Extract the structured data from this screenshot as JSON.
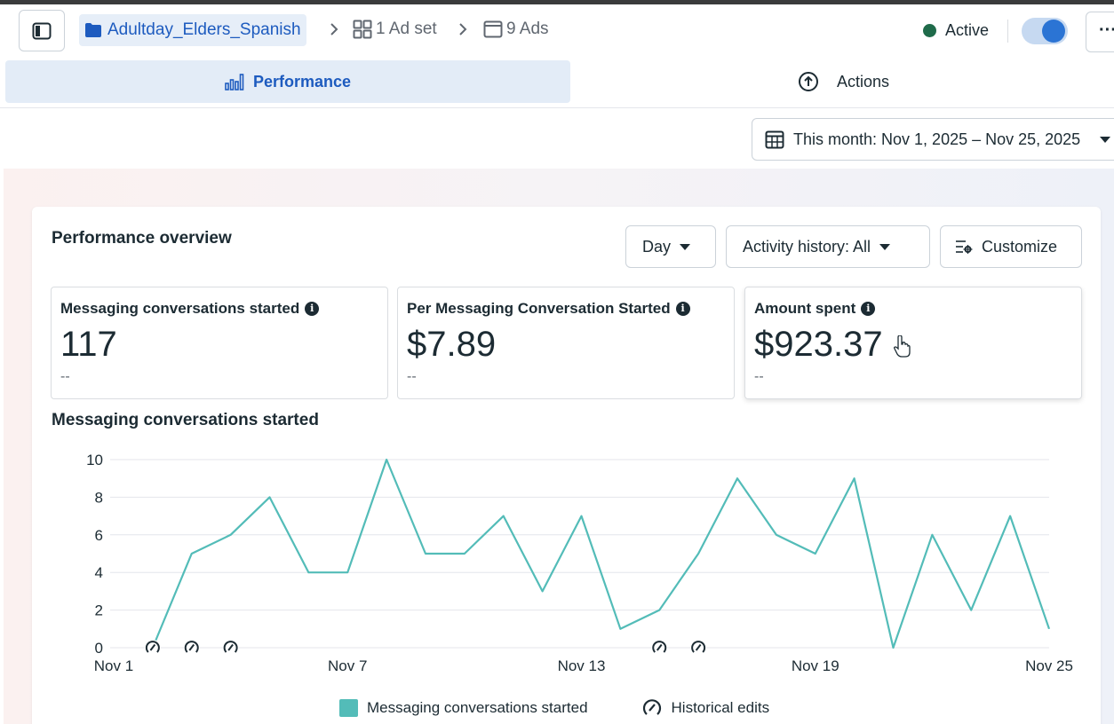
{
  "header": {
    "campaign_name": "Adultday_Elders_Spanish",
    "ad_set_label": "1 Ad set",
    "ads_label": "9 Ads",
    "status": "Active",
    "more_label": "···"
  },
  "tabs": [
    {
      "label": "Performance",
      "active": true
    },
    {
      "label": "Actions",
      "active": false
    }
  ],
  "date_range": {
    "label": "This month: Nov 1, 2025 – Nov 25, 2025"
  },
  "overview": {
    "title": "Performance overview",
    "granularity": "Day",
    "activity_history": "Activity history: All",
    "customize_label": "Customize"
  },
  "metrics": [
    {
      "label": "Messaging conversations started",
      "value": "117",
      "sub": "--"
    },
    {
      "label": "Per Messaging Conversation Started",
      "value": "$7.89",
      "sub": "--"
    },
    {
      "label": "Amount spent",
      "value": "$923.37",
      "sub": "--"
    }
  ],
  "colors": {
    "accent": "#1d5bbf",
    "line": "#53bcb8",
    "status_active": "#1f6b4a"
  },
  "chart_data": {
    "type": "line",
    "title": "Messaging conversations started",
    "xlabel": "",
    "ylabel": "",
    "x_tick_labels": [
      "Nov 1",
      "Nov 7",
      "Nov 13",
      "Nov 19",
      "Nov 25"
    ],
    "ylim": [
      0,
      10
    ],
    "y_ticks": [
      0,
      2,
      4,
      6,
      8,
      10
    ],
    "grid": true,
    "legend_position": "bottom",
    "series": [
      {
        "name": "Messaging conversations started",
        "x": [
          "Nov 3",
          "Nov 4",
          "Nov 5",
          "Nov 6",
          "Nov 7",
          "Nov 8",
          "Nov 9",
          "Nov 10",
          "Nov 11",
          "Nov 12",
          "Nov 13",
          "Nov 14",
          "Nov 15",
          "Nov 16",
          "Nov 17",
          "Nov 18",
          "Nov 19",
          "Nov 20",
          "Nov 21",
          "Nov 22",
          "Nov 23",
          "Nov 24",
          "Nov 25"
        ],
        "values": [
          5,
          6,
          8,
          4,
          4,
          10,
          5,
          5,
          7,
          3,
          7,
          1,
          2,
          5,
          9,
          6,
          5,
          9,
          0,
          6,
          2,
          7,
          1
        ]
      }
    ],
    "historical_edits": [
      "Nov 2",
      "Nov 3",
      "Nov 4",
      "Nov 15",
      "Nov 16"
    ],
    "legend": [
      "Messaging conversations started",
      "Historical edits"
    ]
  }
}
